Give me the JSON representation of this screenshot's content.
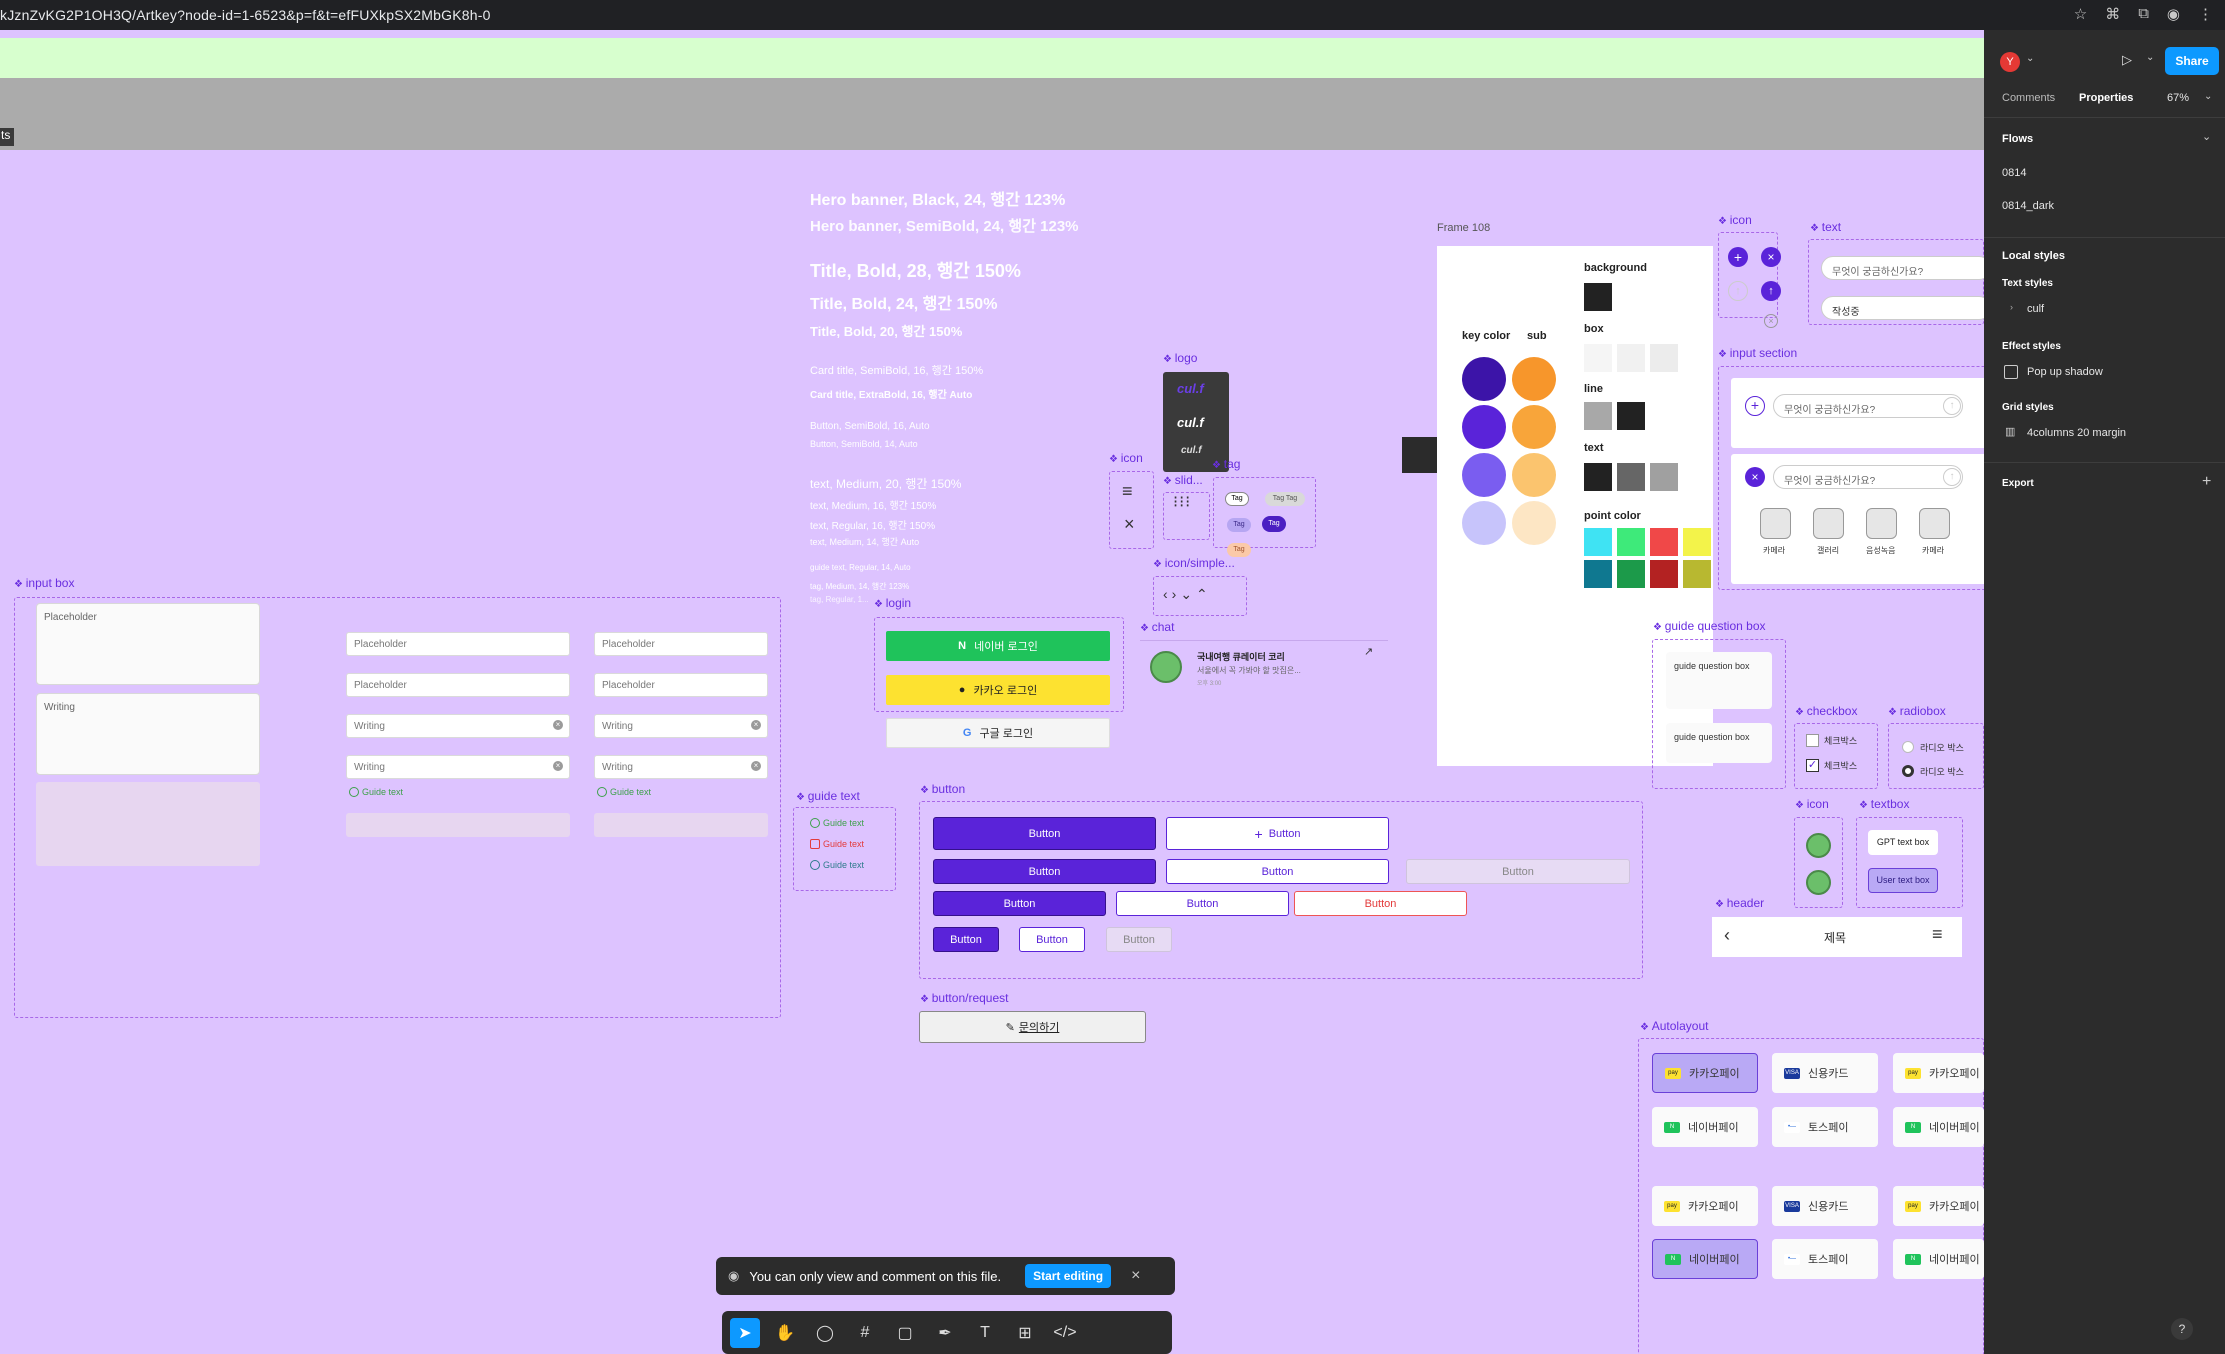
{
  "browser": {
    "url": "kJznZvKG2P1OH3Q/Artkey?node-id=1-6523&p=f&t=efFUXkpSX2MbGK8h-0"
  },
  "canvas": {
    "side_label": "ts",
    "typography": [
      "Hero banner, Black, 24, 행간 123%",
      "Hero banner, SemiBold, 24, 행간 123%",
      "Title, Bold, 28, 행간 150%",
      "Title, Bold, 24, 행간 150%",
      "Title, Bold, 20, 행간 150%",
      "Card title, SemiBold, 16, 행간 150%",
      "Card title, ExtraBold, 16, 행간 Auto",
      "Button, SemiBold, 16, Auto",
      "Button, SemiBold, 14, Auto",
      "text, Medium, 20, 행간 150%",
      "text, Medium, 16, 행간 150%",
      "text, Regular, 16, 행간 150%",
      "text, Medium, 14, 행간 Auto",
      "guide text, Regular, 14, Auto",
      "tag, Medium, 14, 행간 123%",
      "tag, Regular, 1..."
    ],
    "labels": {
      "input_box": "input box",
      "guide_text": "guide text",
      "button": "button",
      "button_request": "button/request",
      "login": "login",
      "chat": "chat",
      "logo": "logo",
      "icon": "icon",
      "slider": "slid...",
      "tag": "tag",
      "icon_simple": "icon/simple...",
      "frame108": "Frame 108",
      "icon2": "icon",
      "text": "text",
      "input_section": "input section",
      "guide_question_box": "guide question box",
      "checkbox": "checkbox",
      "radiobox": "radiobox",
      "icon3": "icon",
      "textbox": "textbox",
      "header": "header",
      "autolayout": "Autolayout"
    },
    "input_box": {
      "placeholder": "Placeholder",
      "writing": "Writing",
      "guide": "Guide text"
    },
    "guide_texts": [
      "Guide text",
      "Guide text",
      "Guide text"
    ],
    "buttons": {
      "label": "Button",
      "plus_label": "Button"
    },
    "request": "문의하기",
    "login": {
      "naver": "네이버 로그인",
      "kakao": "카카오 로그인",
      "google": "구글 로그인"
    },
    "chat": {
      "title": "국내여행 큐레이터 코리",
      "preview": "서울에서 꼭 가봐야 할 맛집은...",
      "time": "오후 3:00"
    },
    "logo_text": [
      "cul.f",
      "cul.f",
      "cul.f"
    ],
    "tags": [
      "Tag",
      "Tag Tag",
      "Tag",
      "Tag",
      "Tag"
    ],
    "frame108": {
      "key_color": "key color",
      "sub": "sub",
      "background": "background",
      "box": "box",
      "line": "line",
      "text": "text",
      "point_color": "point color",
      "key_colors": [
        "#3c14a8",
        "#5a23d9",
        "#7a5df0",
        "#c7c4fb"
      ],
      "sub_colors": [
        "#f7962b",
        "#f8a53a",
        "#fbc46e",
        "#fde6c4"
      ],
      "point_colors": [
        "#3fe3f3",
        "#3eea7a",
        "#f04848",
        "#f3f34a",
        "#0f7890",
        "#1c9a4a",
        "#b32222",
        "#b8b830"
      ]
    },
    "text_fields": {
      "q": "무엇이 궁금하신가요?",
      "typing": "작성중"
    },
    "input_section": {
      "q1": "무엇이 궁금하신가요?",
      "q2": "무엇이 궁금하신가요?",
      "opts": [
        "카메라",
        "갤러리",
        "음성녹음",
        "카메라"
      ]
    },
    "gqbox": [
      "guide question box",
      "guide question box"
    ],
    "checkbox": [
      "체크박스",
      "체크박스"
    ],
    "radiobox": [
      "라디오 박스",
      "라디오 박스"
    ],
    "textbox": {
      "gpt": "GPT text box",
      "user": "User text box"
    },
    "header": {
      "title": "제목"
    },
    "autolayout": {
      "row1": [
        "카카오페이",
        "신용카드",
        "카카오페이"
      ],
      "row2": [
        "네이버페이",
        "토스페이",
        "네이버페이"
      ],
      "row3": [
        "카카오페이",
        "신용카드",
        "카카오페이"
      ],
      "row4": [
        "네이버페이",
        "토스페이",
        "네이버페이"
      ]
    }
  },
  "toast": {
    "message": "You can only view and comment on this file.",
    "action": "Start editing"
  },
  "panel": {
    "avatar": "Y",
    "share": "Share",
    "tab_comments": "Comments",
    "tab_properties": "Properties",
    "zoom": "67%",
    "flows": "Flows",
    "flow_items": [
      "0814",
      "0814_dark"
    ],
    "local_styles": "Local styles",
    "text_styles": "Text styles",
    "culf": "culf",
    "effect_styles": "Effect styles",
    "popup_shadow": "Pop up shadow",
    "grid_styles": "Grid styles",
    "grid_item": "4columns 20 margin",
    "export": "Export",
    "help": "?"
  }
}
